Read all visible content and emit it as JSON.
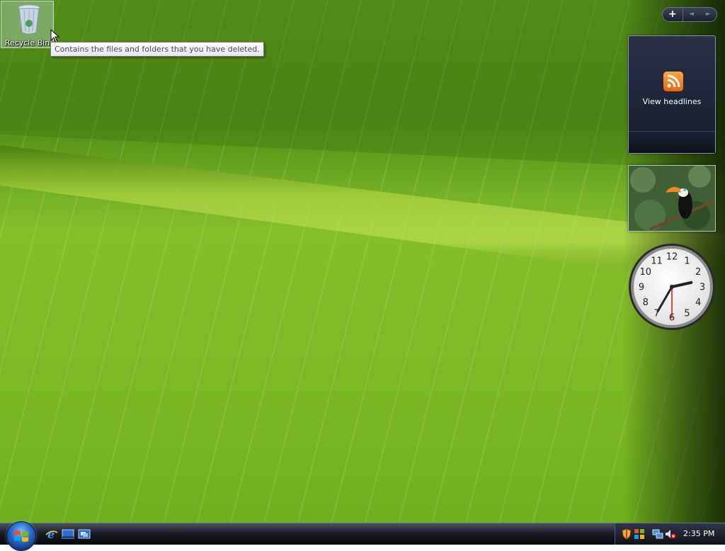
{
  "desktop": {
    "icons": [
      {
        "label": "Recycle Bin",
        "icon": "recycle-bin-icon"
      }
    ],
    "tooltip": "Contains the files and folders that you have deleted."
  },
  "sidebar": {
    "controls": {
      "add": "+",
      "prev": "◄",
      "next": "►"
    },
    "feed_gadget": {
      "label": "View headlines",
      "icon": "rss-icon"
    },
    "slideshow_gadget": {
      "icon": "toucan-photo"
    },
    "clock_gadget": {
      "numerals": [
        "12",
        "1",
        "2",
        "3",
        "4",
        "5",
        "6",
        "7",
        "8",
        "9",
        "10",
        "11"
      ],
      "time": "2:35"
    }
  },
  "taskbar": {
    "start_icon": "windows-logo-icon",
    "quick_launch": [
      "internet-explorer-icon",
      "show-desktop-icon",
      "switch-windows-icon"
    ],
    "tray_icons": [
      "security-shield-icon",
      "windows-update-icon",
      "network-icon",
      "volume-muted-icon"
    ],
    "clock": "2:35 PM"
  },
  "colors": {
    "wallpaper_green": "#7fb927",
    "taskbar": "#1b1f27",
    "rss_orange": "#f08a24"
  }
}
